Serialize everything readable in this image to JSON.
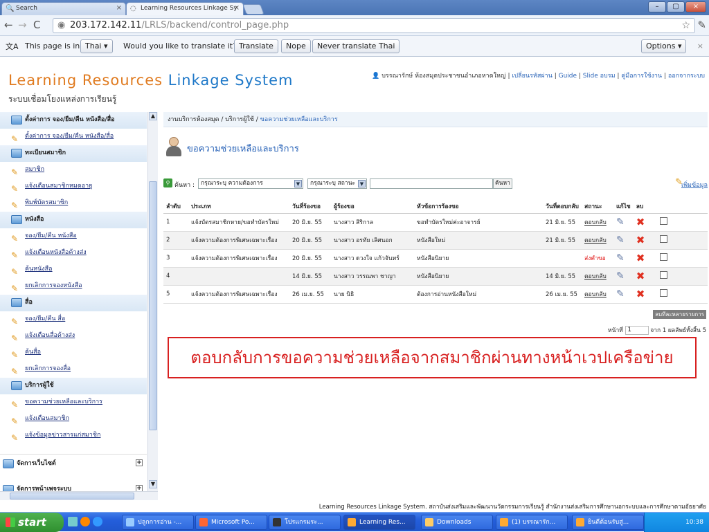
{
  "browser": {
    "tabs": [
      {
        "label": "Search",
        "close": "×"
      },
      {
        "label": "Learning Resources Linkage Sy",
        "close": "×"
      }
    ],
    "url_host": "203.172.142.11",
    "url_path": "/LRLS/backend/control_page.php",
    "window_controls": [
      "–",
      "▢",
      "×"
    ]
  },
  "translate_bar": {
    "prefix": "This page is in",
    "language": "Thai",
    "question": "Would you like to translate it?",
    "translate": "Translate",
    "nope": "Nope",
    "never": "Never translate Thai",
    "options": "Options"
  },
  "header": {
    "logo_1": "Learning Resources",
    "logo_2": " Linkage System",
    "subtitle": "ระบบเชื่อมโยงแหล่งการเรียนรู้",
    "user": "บรรณารักษ์ ห้องสมุดประชาชนอำเภอหาดใหญ่",
    "links": [
      "เปลี่ยนรหัสผ่าน",
      "Guide",
      "Slide อบรม",
      "คู่มือการใช้งาน",
      "ออกจากระบบ"
    ]
  },
  "sidebar": {
    "items": [
      {
        "type": "hdr",
        "label": "ตั้งค่าการ จอง/ยืม/คืน หนังสือ/สื่อ"
      },
      {
        "type": "link",
        "label": "ตั้งค่าการ จอง/ยืม/คืน หนังสือ/สื่อ"
      },
      {
        "type": "hdr",
        "label": "ทะเบียนสมาชิก"
      },
      {
        "type": "link",
        "label": "สมาชิก"
      },
      {
        "type": "link",
        "label": "แจ้งเตือนสมาชิกหมดอายุ"
      },
      {
        "type": "link",
        "label": "พิมพ์บัตรสมาชิก"
      },
      {
        "type": "hdr",
        "label": "หนังสือ"
      },
      {
        "type": "link",
        "label": "จอง/ยืม/คืน หนังสือ"
      },
      {
        "type": "link",
        "label": "แจ้งเตือนหนังสือค้างส่ง"
      },
      {
        "type": "link",
        "label": "ค้นหนังสือ"
      },
      {
        "type": "link",
        "label": "ยกเลิกการจองหนังสือ"
      },
      {
        "type": "hdr",
        "label": "สื่อ"
      },
      {
        "type": "link",
        "label": "จอง/ยืม/คืน สื่อ"
      },
      {
        "type": "link",
        "label": "แจ้งเตือนสื่อค้างส่ง"
      },
      {
        "type": "link",
        "label": "ค้นสื่อ"
      },
      {
        "type": "link",
        "label": "ยกเลิกการจองสื่อ"
      },
      {
        "type": "hdr",
        "label": "บริการผู้ใช้"
      },
      {
        "type": "link",
        "label": "ขอความช่วยเหลือและบริการ"
      },
      {
        "type": "link",
        "label": "แจ้งเตือนสมาชิก"
      },
      {
        "type": "link",
        "label": "แจ้งข้อมูลข่าวสารแก่สมาชิก"
      }
    ],
    "section_web": "จัดการเว็บไซต์",
    "section_next": "จัดการหน้าเพจระบบ"
  },
  "main": {
    "breadcrumb_a": "งานบริการห้องสมุด / บริการผู้ใช้ / ",
    "breadcrumb_b": "ขอความช่วยเหลือและบริการ",
    "title": "ขอความช่วยเหลือและบริการ",
    "search_label": "ค้นหา :",
    "filter_need": "กรุณาระบุ ความต้องการ",
    "filter_status": "กรุณาระบุ สถานะ",
    "search_btn": "ค้นหา",
    "add_btn": "เพิ่มข้อมูล",
    "columns": [
      "ลำดับ",
      "ประเภท",
      "วันที่ร้องขอ",
      "ผู้ร้องขอ",
      "หัวข้อการร้องขอ",
      "วันที่ตอบกลับ",
      "สถานะ",
      "แก้ไข",
      "ลบ",
      ""
    ],
    "rows": [
      {
        "no": "1",
        "type": "แจ้งบัตรสมาชิกหาย/ขอทำบัตรใหม่",
        "date": "20 มิ.ย. 55",
        "by": "นางสาว สิริกาล",
        "subject": "ขอทำบัตรใหม่ค่ะอาจารย์",
        "reply": "21 มิ.ย. 55",
        "status": "ตอบกลับ",
        "status_red": false
      },
      {
        "no": "2",
        "type": "แจ้งความต้องการพิเศษเฉพาะเรื่อง",
        "date": "20 มิ.ย. 55",
        "by": "นางสาว อรทัย เลิศนอก",
        "subject": "หนังสือใหม่",
        "reply": "21 มิ.ย. 55",
        "status": "ตอบกลับ",
        "status_red": false
      },
      {
        "no": "3",
        "type": "แจ้งความต้องการพิเศษเฉพาะเรื่อง",
        "date": "20 มิ.ย. 55",
        "by": "นางสาว ดวงใจ แก้วจันทร์",
        "subject": "หนังสือนิยาย",
        "reply": "",
        "status": "ส่งคำขอ",
        "status_red": true
      },
      {
        "no": "4",
        "type": "",
        "date": "14 มิ.ย. 55",
        "by": "นางสาว วรรณพา ชาญา",
        "subject": "หนังสือนิยาย",
        "reply": "14 มิ.ย. 55",
        "status": "ตอบกลับ",
        "status_red": false
      },
      {
        "no": "5",
        "type": "แจ้งความต้องการพิเศษเฉพาะเรื่อง",
        "date": "26 เม.ย. 55",
        "by": "นาย นิธิ",
        "subject": "ต้องการอ่านหนังสือใหม่",
        "reply": "26 เม.ย. 55",
        "status": "ตอบกลับ",
        "status_red": false
      }
    ],
    "delete_many": "ลบทีละหลายรายการ",
    "page_label": "หน้าที่",
    "page_value": "1",
    "page_of": "จาก 1  ผลลัพธ์ทั้งสิ้น 5",
    "annotation": "ตอบกลับการขอความช่วยเหลือจากสมาชิกผ่านทางหน้าเวปเครือข่าย"
  },
  "footer": "Learning Resources Linkage System. สถาบันส่งเสริมและพัฒนานวัตกรรมการเรียนรู้ สำนักงานส่งเสริมการศึกษานอกระบบและการศึกษาตามอัธยาศัย",
  "taskbar": {
    "start": "start",
    "buttons": [
      "ปลูกการอ่าน -...",
      "Microsoft Po...",
      "โปรแกรมระ...",
      "Learning Res...",
      "Downloads",
      "(1) บรรณารัก...",
      "ยินดีต้อนรับสู่..."
    ],
    "clock": "10:38"
  }
}
